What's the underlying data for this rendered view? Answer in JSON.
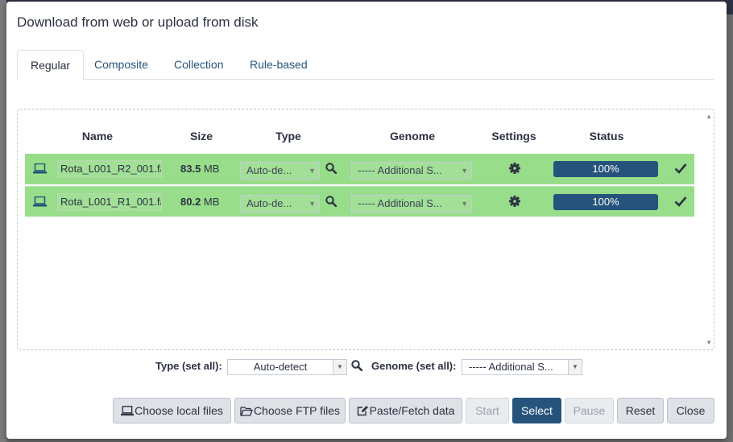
{
  "dialog": {
    "title": "Download from web or upload from disk"
  },
  "tabs": [
    {
      "label": "Regular",
      "active": true
    },
    {
      "label": "Composite",
      "active": false
    },
    {
      "label": "Collection",
      "active": false
    },
    {
      "label": "Rule-based",
      "active": false
    }
  ],
  "table": {
    "headers": {
      "name": "Name",
      "size": "Size",
      "type": "Type",
      "genome": "Genome",
      "settings": "Settings",
      "status": "Status"
    },
    "rows": [
      {
        "name": "Rota_L001_R2_001.fa",
        "size_value": "83.5",
        "size_unit": " MB",
        "type": "Auto-de...",
        "genome": "----- Additional S...",
        "status": "100%",
        "progress": 1.0,
        "state": "success"
      },
      {
        "name": "Rota_L001_R1_001.fa",
        "size_value": "80.2",
        "size_unit": " MB",
        "type": "Auto-de...",
        "genome": "----- Additional S...",
        "status": "100%",
        "progress": 1.0,
        "state": "success"
      }
    ]
  },
  "footer": {
    "type_label": "Type (set all):",
    "type_value": "Auto-detect",
    "genome_label": "Genome (set all):",
    "genome_value": "----- Additional S..."
  },
  "buttons": {
    "choose_local": "Choose local files",
    "choose_ftp": "Choose FTP files",
    "paste_fetch": "Paste/Fetch data",
    "start": "Start",
    "select": "Select",
    "pause": "Pause",
    "reset": "Reset",
    "close": "Close"
  },
  "colors": {
    "row_success": "#97dd8a",
    "progress": "#25537b",
    "primary": "#25537b"
  }
}
